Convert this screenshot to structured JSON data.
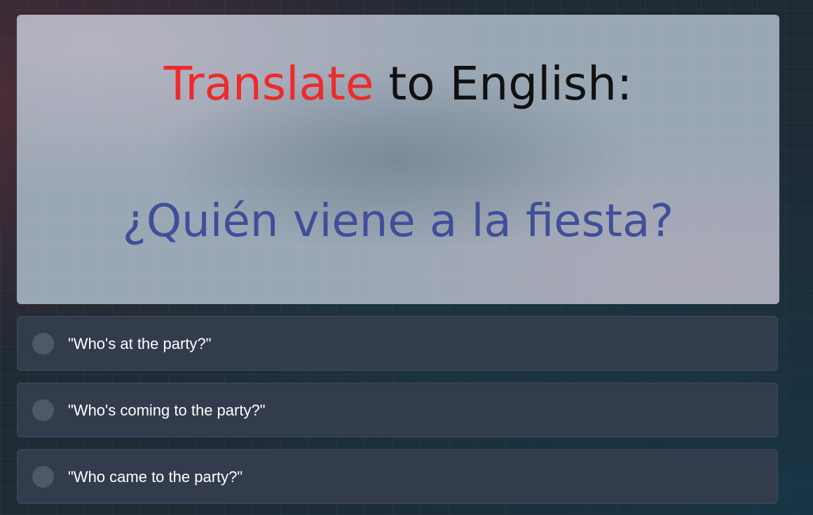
{
  "question": {
    "prompt_highlight": "Translate",
    "prompt_rest": " to English:",
    "phrase": "¿Quién viene a la fiesta?"
  },
  "options": [
    {
      "label": "\"Who's at the party?\""
    },
    {
      "label": "\"Who's coming to the party?\""
    },
    {
      "label": "\"Who came to the party?\""
    }
  ],
  "colors": {
    "highlight": "#ee2a2a",
    "phrase": "#3f4f9a",
    "option_background": "#323c4c",
    "radio": "#4e5869"
  }
}
